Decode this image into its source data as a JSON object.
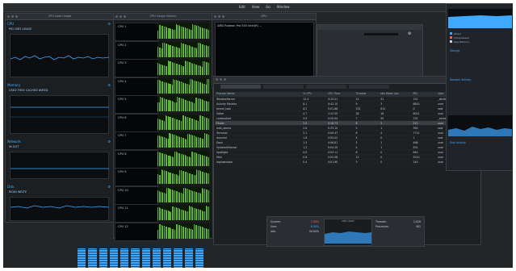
{
  "menubar": {
    "items": [
      "Edit",
      "View",
      "Go",
      "Window"
    ]
  },
  "left_window": {
    "title": "CPU Load Usage",
    "panels": [
      {
        "name": "CPU",
        "stats": "PID   CMD   USAGE"
      },
      {
        "name": "Memory",
        "stats": "USED  FREE  CACHED  WIRED"
      },
      {
        "name": "Network",
        "stats": "IN    OUT"
      },
      {
        "name": "Disk",
        "stats": "READ  WRITE"
      }
    ]
  },
  "cpu_history": {
    "title": "CPU Usage History",
    "labels": [
      "CPU 1",
      "CPU 2",
      "CPU 3",
      "CPU 4",
      "CPU 5",
      "CPU 6",
      "CPU 7",
      "CPU 8",
      "CPU 9",
      "CPU 10",
      "CPU 11",
      "CPU 12"
    ]
  },
  "gpu_window": {
    "title": "GPU",
    "graph_label": "AMD Radeon Pro 555 Intel(R) ..."
  },
  "process_table": {
    "columns": [
      "Process Name",
      "% CPU",
      "CPU Time",
      "Threads",
      "Idle Wake Ups",
      "PID",
      "User"
    ],
    "rows": [
      [
        "WindowServer",
        "12.4",
        "3:15.21",
        "12",
        "41",
        "152",
        "_windowserver"
      ],
      [
        "Activity Monitor",
        "8.1",
        "0:42.10",
        "9",
        "3",
        "8810",
        "user"
      ],
      [
        "kernel_task",
        "6.2",
        "5:01.88",
        "232",
        "612",
        "0",
        "root"
      ],
      [
        "Safari",
        "4.7",
        "1:12.55",
        "28",
        "18",
        "6021",
        "user"
      ],
      [
        "coreaudiod",
        "3.9",
        "0:20.04",
        "7",
        "55",
        "231",
        "_coreaudiod"
      ],
      [
        "Finder",
        "3.0",
        "0:18.73",
        "6",
        "2",
        "512",
        "user"
      ],
      [
        "mds_stores",
        "2.6",
        "0:33.10",
        "5",
        "1",
        "390",
        "root"
      ],
      [
        "Terminal",
        "2.1",
        "0:09.47",
        "8",
        "4",
        "7712",
        "user"
      ],
      [
        "launchd",
        "1.8",
        "0:55.02",
        "4",
        "0",
        "1",
        "root"
      ],
      [
        "Dock",
        "1.5",
        "0:06.81",
        "5",
        "1",
        "498",
        "user"
      ],
      [
        "SystemUIServer",
        "1.2",
        "0:04.20",
        "4",
        "1",
        "501",
        "user"
      ],
      [
        "Spotlight",
        "0.9",
        "0:03.11",
        "6",
        "0",
        "640",
        "user"
      ],
      [
        "Mail",
        "0.6",
        "0:02.58",
        "12",
        "0",
        "5210",
        "user"
      ],
      [
        "loginwindow",
        "0.4",
        "0:01.90",
        "3",
        "0",
        "140",
        "user"
      ]
    ]
  },
  "summary": {
    "rows": [
      {
        "label": "System:",
        "value": "2.88%"
      },
      {
        "label": "User:",
        "value": "6.48%"
      },
      {
        "label": "Idle:",
        "value": "90.64%"
      }
    ],
    "center_title": "CPU LOAD",
    "right_rows": [
      {
        "label": "Threads:",
        "value": "2,026"
      },
      {
        "label": "Processes:",
        "value": "481"
      }
    ]
  },
  "right_sidebar": {
    "sections": [
      "Memory",
      "Storage",
      "Network Activity",
      "Disk Activity"
    ],
    "legend": [
      {
        "name": "Wired",
        "color": "#3fa8ff"
      },
      {
        "name": "Compressed",
        "color": "#ff5a4f"
      },
      {
        "name": "App Memory",
        "color": "#cfd8e0"
      }
    ]
  },
  "colors": {
    "accent": "#3fa8ff",
    "cpu_green": "#5fb636"
  }
}
